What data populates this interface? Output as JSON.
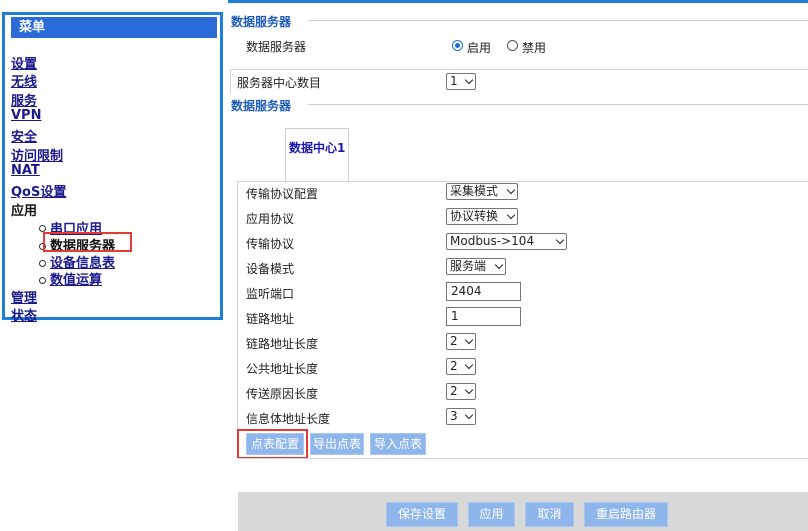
{
  "menu": {
    "title": "菜单",
    "items": [
      "设置",
      "无线",
      "服务",
      "VPN",
      "安全",
      "访问限制",
      "NAT",
      "QoS设置"
    ],
    "app_label": "应用",
    "sub_items": [
      "串口应用",
      "数据服务器",
      "设备信息表",
      "数值运算"
    ],
    "bottom_items": [
      "管理",
      "状态"
    ]
  },
  "server": {
    "section_title": "数据服务器",
    "label": "数据服务器",
    "enable_label": "启用",
    "disable_label": "禁用",
    "enabled": true,
    "count_label": "服务器中心数目",
    "count_value": "1"
  },
  "section2_title": "数据服务器",
  "tab": {
    "label": "数据中心1"
  },
  "fields": {
    "transport_config": {
      "label": "传输协议配置",
      "value": "采集模式"
    },
    "app_protocol": {
      "label": "应用协议",
      "value": "协议转换"
    },
    "transport_protocol": {
      "label": "传输协议",
      "value": "Modbus->104"
    },
    "device_mode": {
      "label": "设备模式",
      "value": "服务端"
    },
    "listen_port": {
      "label": "监听端口",
      "value": "2404"
    },
    "link_addr": {
      "label": "链路地址",
      "value": "1"
    },
    "link_addr_len": {
      "label": "链路地址长度",
      "value": "2"
    },
    "common_addr_len": {
      "label": "公共地址长度",
      "value": "2"
    },
    "cause_len": {
      "label": "传送原因长度",
      "value": "2"
    },
    "info_addr_len": {
      "label": "信息体地址长度",
      "value": "3"
    }
  },
  "buttons": {
    "point_config": "点表配置",
    "export_points": "导出点表",
    "import_points": "导入点表"
  },
  "footer": {
    "save": "保存设置",
    "apply": "应用",
    "cancel": "取消",
    "reboot": "重启路由器"
  }
}
